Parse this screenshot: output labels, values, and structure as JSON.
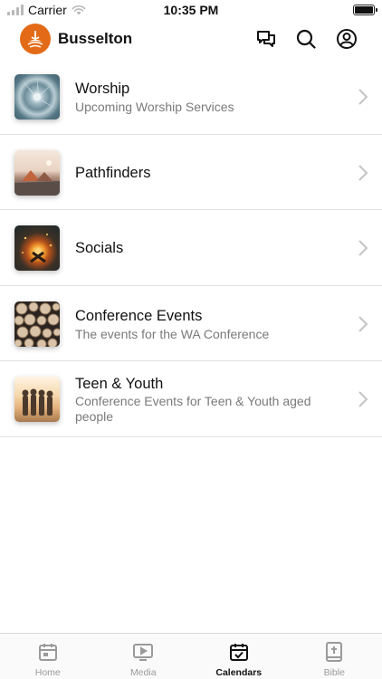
{
  "status_bar": {
    "carrier": "Carrier",
    "time": "10:35 PM"
  },
  "header": {
    "title": "Busselton",
    "logo_color": "#e36b17",
    "icons": [
      "messages-icon",
      "search-icon",
      "account-icon"
    ]
  },
  "calendars": [
    {
      "title": "Worship",
      "subtitle": "Upcoming Worship Services",
      "thumb": "agave-plant"
    },
    {
      "title": "Pathfinders",
      "subtitle": "",
      "thumb": "campsite-tents"
    },
    {
      "title": "Socials",
      "subtitle": "",
      "thumb": "campfire-night"
    },
    {
      "title": "Conference Events",
      "subtitle": "The events for the WA Conference",
      "thumb": "stacked-logs"
    },
    {
      "title": "Teen & Youth",
      "subtitle": "Conference Events for Teen & Youth aged people",
      "thumb": "friends-sunset"
    }
  ],
  "tabbar": {
    "tabs": [
      {
        "label": "Home",
        "icon": "home-calendar-icon",
        "active": false
      },
      {
        "label": "Media",
        "icon": "media-play-icon",
        "active": false
      },
      {
        "label": "Calendars",
        "icon": "calendar-check-icon",
        "active": true
      },
      {
        "label": "Bible",
        "icon": "bible-icon",
        "active": false
      }
    ]
  }
}
